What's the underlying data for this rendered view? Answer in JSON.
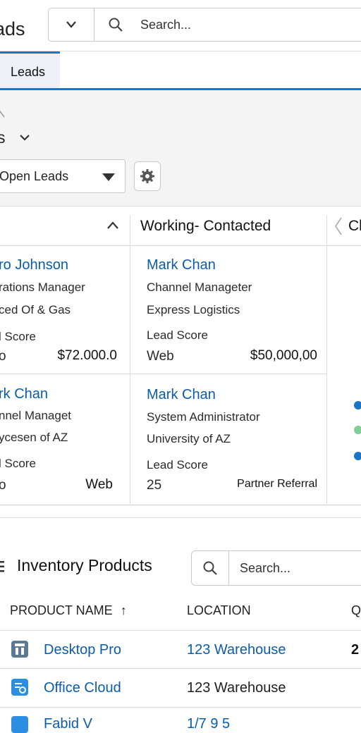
{
  "header": {
    "app_title": "ads",
    "search_placeholder": "Search..."
  },
  "tabs": [
    {
      "label": "Leads",
      "active": true
    }
  ],
  "page": {
    "list_title": "s",
    "list_view_select": "Open Leads"
  },
  "kanban": {
    "columns": [
      {
        "title": "",
        "cards": [
          {
            "name": "ro Johnson",
            "title": "rations Manager",
            "company": "ced Of & Gas",
            "score_label": "l Score",
            "left_value": "o",
            "right_value": "$72.000.0"
          },
          {
            "name": "rk Chan",
            "title": "nnel Managet",
            "company": "ycesen of AZ",
            "score_label": "l Score",
            "left_value": "o",
            "right_value": "Web"
          }
        ]
      },
      {
        "title": "Working- Contacted",
        "cards": [
          {
            "name": "Mark Chan",
            "title": "Channel Manageter",
            "company": "Express Logistics",
            "score_label": "Lead Score",
            "left_value": "Web",
            "right_value": "$50,000,00"
          },
          {
            "name": "Mark Chan",
            "title": "System Administrator",
            "company": "University of AZ",
            "score_label": "Lead Score",
            "left_value": "25",
            "right_value": "Partner Referral"
          }
        ]
      },
      {
        "title": "Cl"
      }
    ],
    "status_dot_colors": [
      "#1b74c5",
      "#7fcf96",
      "#1b74c5"
    ]
  },
  "inventory": {
    "title": "Inventory Products",
    "search_placeholder": "Search...",
    "columns": [
      "PRODUCT NAME",
      "LOCATION",
      "Q"
    ],
    "sort_indicator": "↑",
    "rows": [
      {
        "name": "Desktop Pro",
        "location": "123 Warehouse",
        "location_is_link": true,
        "qty": "2",
        "icon": "server-icon",
        "icon_color": "#5a7a96"
      },
      {
        "name": "Office Cloud",
        "location": "123 Warehouse",
        "location_is_link": false,
        "qty": "",
        "icon": "cloud-app-icon",
        "icon_color": "#2b8ee0"
      },
      {
        "name": "Fabid V",
        "location": "1/7 9 5",
        "location_is_link": true,
        "qty": "",
        "icon": "product-icon",
        "icon_color": "#2b8ee0"
      }
    ]
  }
}
